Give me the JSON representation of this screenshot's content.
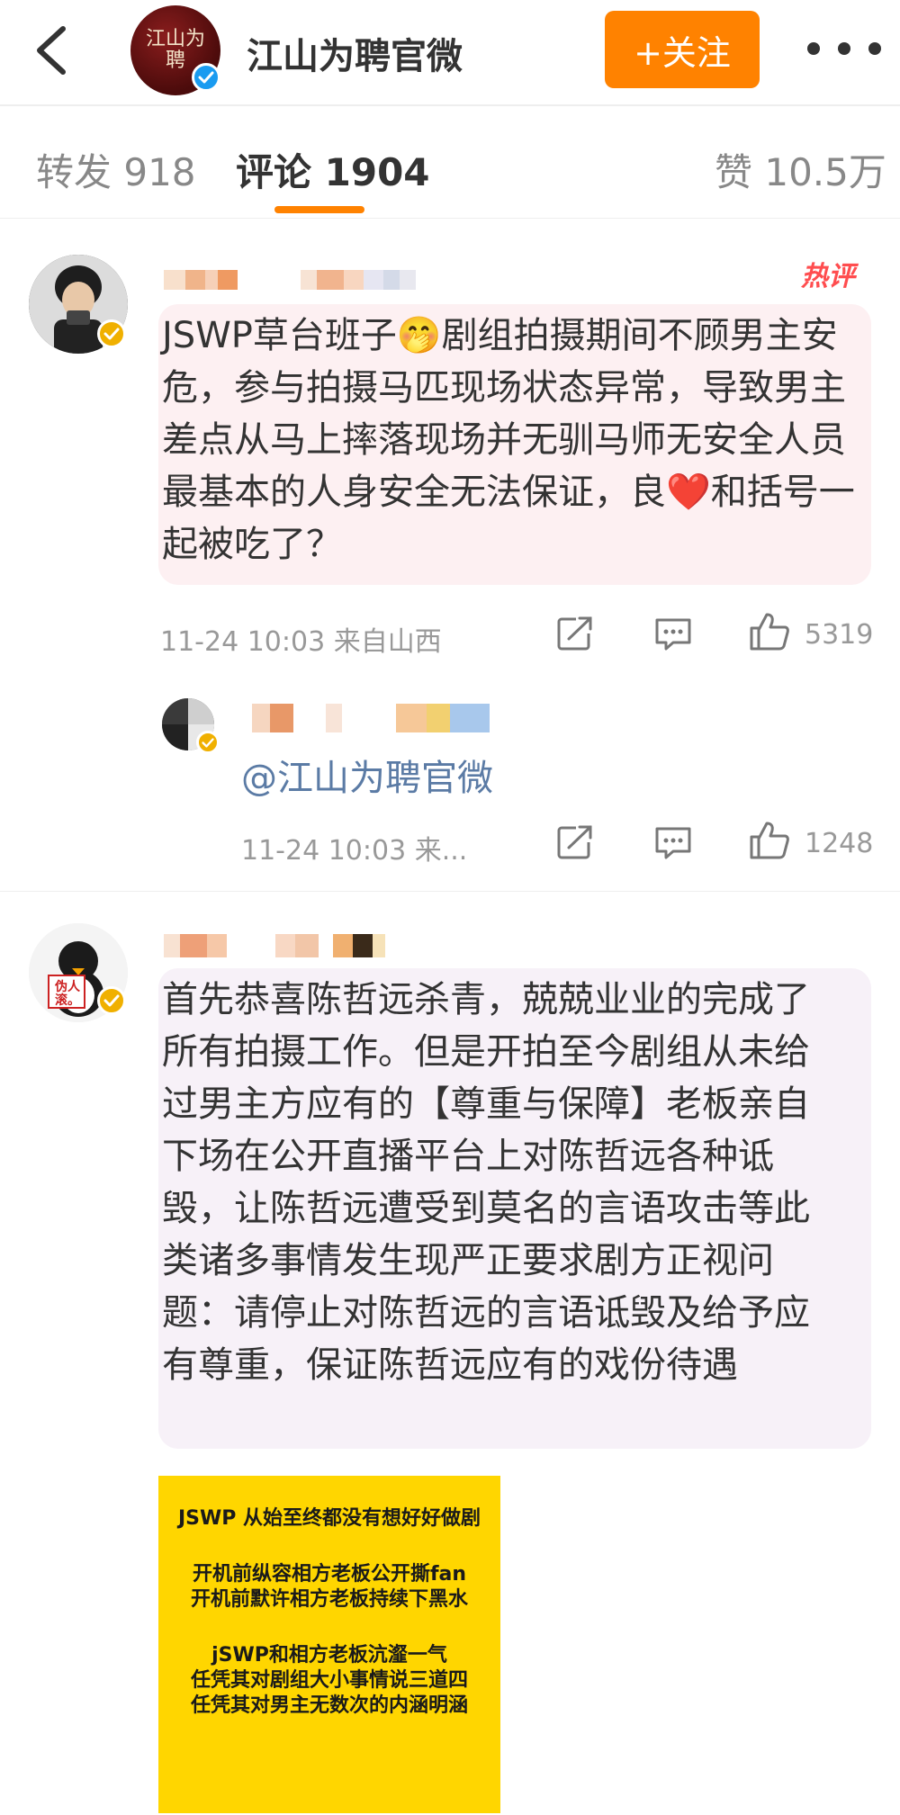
{
  "header": {
    "account_name": "江山为聘官微",
    "avatar_text": "江山为聘",
    "follow_label": "+关注"
  },
  "tabs": {
    "repost": "转发 918",
    "comments": "评论 1904",
    "likes": "赞 10.5万"
  },
  "comments": [
    {
      "badge": "热评",
      "text": "JSWP草台班子🤭剧组拍摄期间不顾男主安危，参与拍摄马匹现场状态异常，导致男主差点从马上摔落现场并无驯马师无安全人员 最基本的人身安全无法保证，良❤️和括号一起被吃了？",
      "time": "11-24 10:03  来自山西",
      "likes": "5319",
      "reply": {
        "text": "@江山为聘官微",
        "time": "11-24 10:03  来...",
        "likes": "1248"
      }
    },
    {
      "avatar_text": "伪人滚。",
      "text": "首先恭喜陈哲远杀青，兢兢业业的完成了所有拍摄工作。但是开拍至今剧组从未给过男主方应有的【尊重与保障】老板亲自下场在公开直播平台上对陈哲远各种诋毁，让陈哲远遭受到莫名的言语攻击等此类诸多事情发生现严正要求剧方正视问题：请停止对陈哲远的言语诋毁及给予应有尊重，保证陈哲远应有的戏份待遇",
      "image_lines": [
        "JSWP 从始至终都没有想好好做剧",
        "开机前纵容相方老板公开撕fan",
        "开机前默许相方老板持续下黑水",
        "jSWP和相方老板沆瀣一气",
        "任凭其对剧组大小事情说三道四",
        "任凭其对男主无数次的内涵明涵"
      ]
    }
  ],
  "colors": {
    "accent": "#ff8200",
    "verified_blue": "#1a9bf0",
    "verified_gold": "#f0b000",
    "hot": "#ff4d4f",
    "mention": "#5b7ba5"
  }
}
